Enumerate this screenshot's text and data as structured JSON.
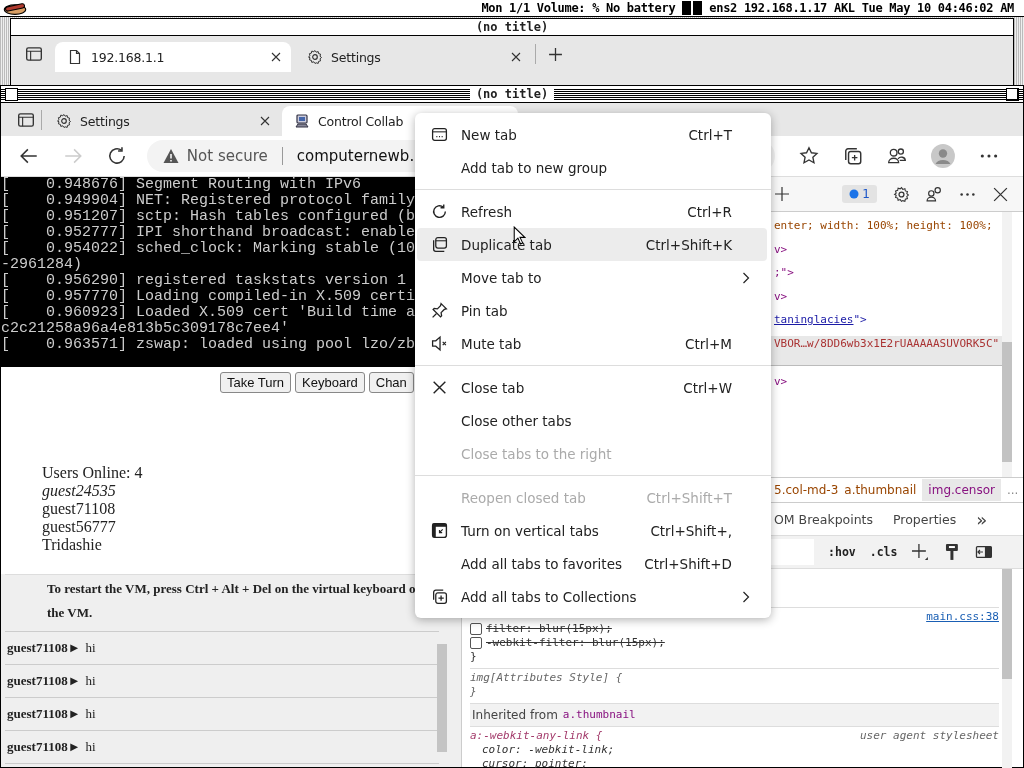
{
  "menubar": {
    "status": "Mon 1/1 Volume: % No battery",
    "network": "ens2 192.168.1.17 AKL Tue May 10 04:46:02 AM"
  },
  "back_window": {
    "title": "(no title)",
    "tabs": [
      {
        "label": "192.168.1.1",
        "selected": true,
        "kind": "page"
      },
      {
        "label": "Settings",
        "selected": false,
        "kind": "settings"
      }
    ]
  },
  "window": {
    "title": "(no title)",
    "tabs": [
      {
        "label": "Settings",
        "selected": false,
        "kind": "settings"
      },
      {
        "label": "Control Collab",
        "selected": true,
        "kind": "computer"
      }
    ],
    "address": {
      "security": "Not secure",
      "url": "computernewb."
    }
  },
  "page": {
    "console_lines": [
      "[    0.948676] Segment Routing with IPv6",
      "[    0.949904] NET: Registered protocol family",
      "[    0.951207] sctp: Hash tables configured (b",
      "[    0.952777] IPI shorthand broadcast: enable",
      "[    0.954022] sched_clock: Marking stable (10",
      "-2961284)",
      "[    0.956290] registered taskstats version 1",
      "[    0.957770] Loading compiled-in X.509 certi",
      "[    0.960923] Loaded X.509 cert 'Build time a",
      "c2c21258a96a4e813b5c309178c7ee4'",
      "[    0.963571] zswap: loaded using pool lzo/zb"
    ],
    "buttons": [
      "Take Turn",
      "Keyboard",
      "Chan"
    ],
    "users_label": "Users Online: 4",
    "users": [
      {
        "name": "guest24535",
        "self": true
      },
      {
        "name": "guest71108",
        "self": false
      },
      {
        "name": "guest56777",
        "self": false
      },
      {
        "name": "Tridashie",
        "self": false
      }
    ],
    "notice_lines": [
      "To restart the VM, press Ctrl + Alt + Del on the virtual keyboard o",
      "the VM."
    ],
    "chat": [
      {
        "user": "guest71108►",
        "message": "hi"
      },
      {
        "user": "guest71108►",
        "message": "hi"
      },
      {
        "user": "guest71108►",
        "message": "hi"
      },
      {
        "user": "guest71108►",
        "message": "hi"
      }
    ]
  },
  "devtools": {
    "badge": "1",
    "code_lines": [
      {
        "text": "enter; width: 100%; height: 100%;",
        "kind": "attr",
        "selected": false
      },
      {
        "text": "v>",
        "kind": "tag",
        "selected": false
      },
      {
        "text": ";\">",
        "kind": "tag",
        "selected": false
      },
      {
        "text": "v>",
        "kind": "tag",
        "selected": false
      },
      {
        "text": "taninglacies",
        "tail": "\">",
        "kind": "link",
        "selected": false
      },
      {
        "text": "VBOR…w/8DD6wb3x1E2rUAAAAASUVORK5C\"",
        "kind": "value",
        "selected": true
      },
      {
        "text": "v>",
        "kind": "tag",
        "selected": false
      }
    ],
    "breadcrumbs": [
      {
        "text": "5.col-md-3",
        "selected": false
      },
      {
        "text": "a.thumbnail",
        "selected": false
      },
      {
        "text": "img.censor",
        "selected": true
      }
    ],
    "breadcrumb_more": "...",
    "panel_tabs": [
      "OM Breakpoints",
      "Properties"
    ],
    "panel_more": "»",
    "style_buttons": [
      ":hov",
      ".cls"
    ],
    "rule": {
      "source": "main.css:38",
      "declarations": [
        {
          "text": "filter: blur(15px);",
          "enabled": false
        },
        {
          "text": "-webkit-filter: blur(15px);",
          "enabled": false
        }
      ],
      "close": "}"
    },
    "attributes_rule": {
      "selector": "img[Attributes Style] {",
      "close": "}"
    },
    "inherited": {
      "label": "Inherited from",
      "from": "a.thumbnail"
    },
    "ua_rule": {
      "selector": "a:-webkit-any-link {",
      "source": "user agent stylesheet",
      "declarations": [
        "color: -webkit-link;",
        "cursor: pointer;"
      ]
    }
  },
  "context_menu": {
    "groups": [
      [
        {
          "label": "New tab",
          "shortcut": "Ctrl+T",
          "kind": "new-tab",
          "disabled": false,
          "highlighted": false,
          "submenu": false
        },
        {
          "label": "Add tab to new group",
          "kind": "plain",
          "disabled": false,
          "highlighted": false,
          "submenu": false
        }
      ],
      [
        {
          "label": "Refresh",
          "shortcut": "Ctrl+R",
          "kind": "refresh",
          "disabled": false,
          "highlighted": false,
          "submenu": false
        },
        {
          "label": "Duplicate tab",
          "shortcut": "Ctrl+Shift+K",
          "kind": "duplicate",
          "disabled": false,
          "highlighted": true,
          "submenu": false
        },
        {
          "label": "Move tab to",
          "kind": "plain",
          "disabled": false,
          "highlighted": false,
          "submenu": true
        },
        {
          "label": "Pin tab",
          "kind": "pin",
          "disabled": false,
          "highlighted": false,
          "submenu": false
        },
        {
          "label": "Mute tab",
          "shortcut": "Ctrl+M",
          "kind": "mute",
          "disabled": false,
          "highlighted": false,
          "submenu": false
        }
      ],
      [
        {
          "label": "Close tab",
          "shortcut": "Ctrl+W",
          "kind": "close",
          "disabled": false,
          "highlighted": false,
          "submenu": false
        },
        {
          "label": "Close other tabs",
          "kind": "plain",
          "disabled": false,
          "highlighted": false,
          "submenu": false
        },
        {
          "label": "Close tabs to the right",
          "kind": "plain",
          "disabled": true,
          "highlighted": false,
          "submenu": false
        }
      ],
      [
        {
          "label": "Reopen closed tab",
          "shortcut": "Ctrl+Shift+T",
          "kind": "plain",
          "disabled": true,
          "highlighted": false,
          "submenu": false
        },
        {
          "label": "Turn on vertical tabs",
          "shortcut": "Ctrl+Shift+,",
          "kind": "vertical-tabs",
          "disabled": false,
          "highlighted": false,
          "submenu": false
        },
        {
          "label": "Add all tabs to favorites",
          "shortcut": "Ctrl+Shift+D",
          "kind": "plain",
          "disabled": false,
          "highlighted": false,
          "submenu": false
        },
        {
          "label": "Add all tabs to Collections",
          "kind": "collections",
          "disabled": false,
          "highlighted": false,
          "submenu": true
        }
      ]
    ]
  }
}
